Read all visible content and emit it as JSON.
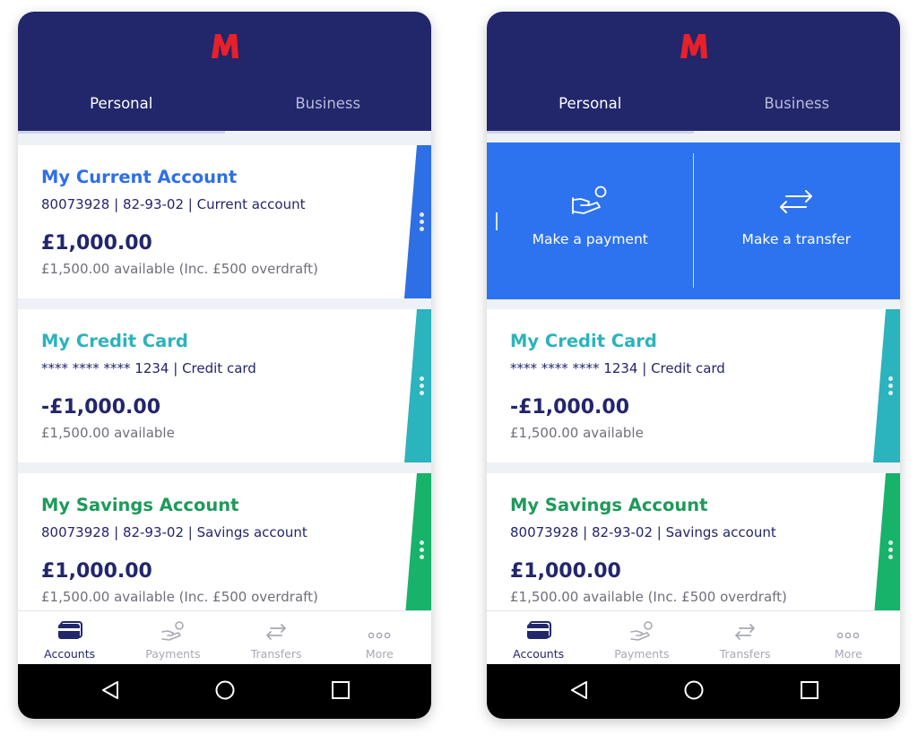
{
  "screens": [
    {
      "tabs": [
        "Personal",
        "Business"
      ],
      "accounts": [
        {
          "name": "My Current Account",
          "details": "80073928 | 82-93-02 | Current account",
          "balance": "£1,000.00",
          "available": "£1,500.00 available (Inc. £500 overdraft)"
        },
        {
          "name": "My Credit Card",
          "details": "**** **** **** 1234 | Credit card",
          "balance": "-£1,000.00",
          "available": "£1,500.00 available"
        },
        {
          "name": "My Savings Account",
          "details": "80073928 | 82-93-02 | Savings account",
          "balance": "£1,000.00",
          "available": "£1,500.00 available (Inc. £500 overdraft)"
        }
      ]
    },
    {
      "tabs": [
        "Personal",
        "Business"
      ],
      "actions": [
        "Make a payment",
        "Make a transfer"
      ],
      "accounts": [
        {
          "name": "My Credit Card",
          "details": "**** **** **** 1234 | Credit card",
          "balance": "-£1,000.00",
          "available": "£1,500.00 available"
        },
        {
          "name": "My Savings Account",
          "details": "80073928 | 82-93-02 | Savings account",
          "balance": "£1,000.00",
          "available": "£1,500.00 available (Inc. £500 overdraft)"
        }
      ]
    }
  ],
  "nav": [
    "Accounts",
    "Payments",
    "Transfers",
    "More"
  ],
  "colors": {
    "header": "#22266b",
    "brand_logo": "#e8202a",
    "current_account": "#2f6fe6",
    "credit_card": "#2bb3be",
    "savings_account": "#1e9a5a",
    "action_panel": "#2d73ef"
  },
  "icons": {
    "logo": "m-logo",
    "accounts": "cards-icon",
    "payments": "hand-coin-icon",
    "transfers": "arrows-transfer-icon",
    "more": "ellipsis-icon",
    "account_menu": "vertical-dots-icon",
    "android_back": "back-triangle-icon",
    "android_home": "home-circle-icon",
    "android_recents": "recents-square-icon"
  }
}
